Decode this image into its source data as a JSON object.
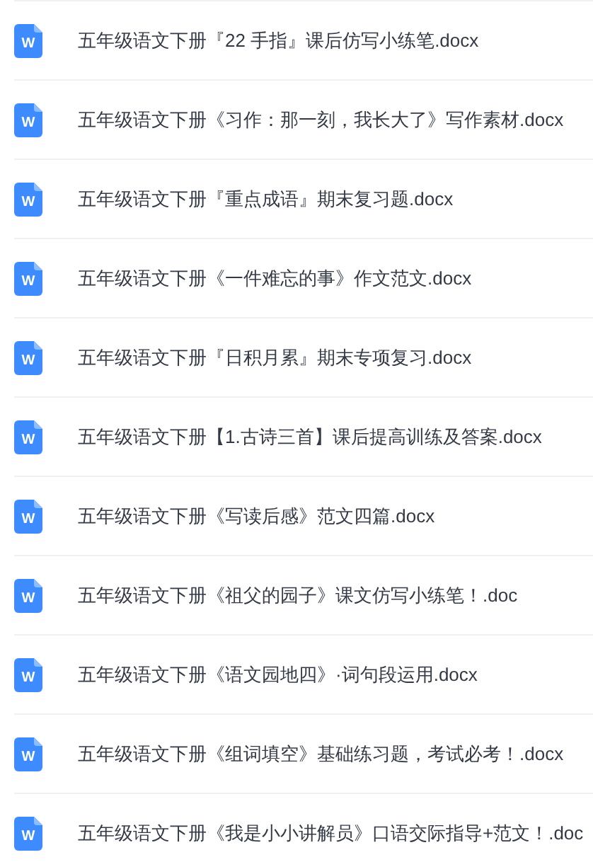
{
  "files": [
    {
      "icon_letter": "W",
      "name": "五年级语文下册『22 手指』课后仿写小练笔.docx"
    },
    {
      "icon_letter": "W",
      "name": "五年级语文下册《习作：那一刻，我长大了》写作素材.docx"
    },
    {
      "icon_letter": "W",
      "name": "五年级语文下册『重点成语』期末复习题.docx"
    },
    {
      "icon_letter": "W",
      "name": "五年级语文下册《一件难忘的事》作文范文.docx"
    },
    {
      "icon_letter": "W",
      "name": "五年级语文下册『日积月累』期末专项复习.docx"
    },
    {
      "icon_letter": "W",
      "name": "五年级语文下册【1.古诗三首】课后提高训练及答案.docx"
    },
    {
      "icon_letter": "W",
      "name": "五年级语文下册《写读后感》范文四篇.docx"
    },
    {
      "icon_letter": "W",
      "name": "五年级语文下册《祖父的园子》课文仿写小练笔！.doc"
    },
    {
      "icon_letter": "W",
      "name": "五年级语文下册《语文园地四》·词句段运用.docx"
    },
    {
      "icon_letter": "W",
      "name": "五年级语文下册《组词填空》基础练习题，考试必考！.docx"
    },
    {
      "icon_letter": "W",
      "name": "五年级语文下册《我是小小讲解员》口语交际指导+范文！.doc"
    }
  ]
}
